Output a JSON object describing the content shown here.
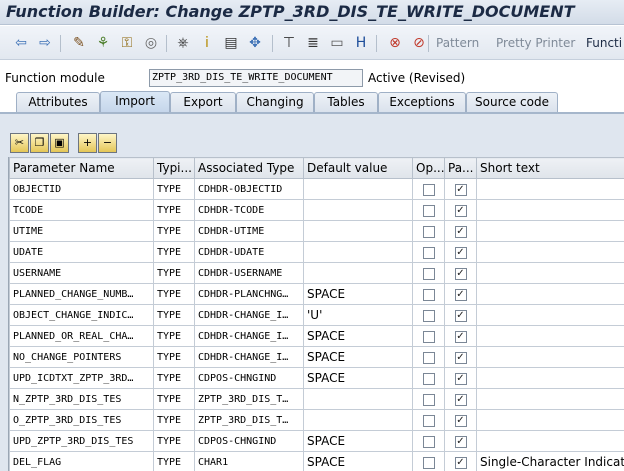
{
  "window": {
    "title": "Function Builder: Change ZPTP_3RD_DIS_TE_WRITE_DOCUMENT"
  },
  "toolbar": {
    "buttons": [
      {
        "name": "back-arrow-icon",
        "glyph": "⇦",
        "color": "#3a6fb5"
      },
      {
        "name": "forward-arrow-icon",
        "glyph": "⇨",
        "color": "#3a6fb5"
      },
      {
        "name": "display-change-icon",
        "glyph": "✎",
        "color": "#7a4f1e"
      },
      {
        "name": "other-object-icon",
        "glyph": "⚘",
        "color": "#4d7f2c"
      },
      {
        "name": "activate-icon",
        "glyph": "⚿",
        "color": "#8a6100"
      },
      {
        "name": "check-icon",
        "glyph": "◎",
        "color": "#666666"
      },
      {
        "name": "where-used-icon",
        "glyph": "⎈",
        "color": "#333333"
      },
      {
        "name": "info-icon",
        "glyph": "ⅰ",
        "color": "#b58a00"
      },
      {
        "name": "object-list-icon",
        "glyph": "▤",
        "color": "#333333"
      },
      {
        "name": "navigate-icon",
        "glyph": "✥",
        "color": "#3a6fb5"
      },
      {
        "name": "hierarchy-icon",
        "glyph": "⊤",
        "color": "#333333"
      },
      {
        "name": "stack-icon",
        "glyph": "≣",
        "color": "#333333"
      },
      {
        "name": "window-icon",
        "glyph": "▭",
        "color": "#555555"
      },
      {
        "name": "help-icon",
        "glyph": "H",
        "color": "#1e4e9a"
      },
      {
        "name": "set-breakpoint-icon",
        "glyph": "⊗",
        "color": "#c0392b"
      },
      {
        "name": "delete-breakpoint-icon",
        "glyph": "⊘",
        "color": "#c0392b"
      }
    ],
    "pattern_label": "Pattern",
    "pretty_printer_label": "Pretty Printer",
    "function_module_button_label": "Functi"
  },
  "function_module": {
    "label": "Function module",
    "value": "ZPTP_3RD_DIS_TE_WRITE_DOCUMENT",
    "status": "Active (Revised)"
  },
  "tabs": [
    {
      "label": "Attributes",
      "active": false
    },
    {
      "label": "Import",
      "active": true
    },
    {
      "label": "Export",
      "active": false
    },
    {
      "label": "Changing",
      "active": false
    },
    {
      "label": "Tables",
      "active": false
    },
    {
      "label": "Exceptions",
      "active": false
    },
    {
      "label": "Source code",
      "active": false
    }
  ],
  "table_toolbar": [
    {
      "name": "cut-icon",
      "glyph": "✂"
    },
    {
      "name": "copy-icon",
      "glyph": "❐"
    },
    {
      "name": "paste-icon",
      "glyph": "▣"
    },
    {
      "name": "insert-row-icon",
      "glyph": "+"
    },
    {
      "name": "delete-row-icon",
      "glyph": "−"
    }
  ],
  "table": {
    "headers": [
      "Parameter Name",
      "Typi...",
      "Associated Type",
      "Default value",
      "Op...",
      "Pa...",
      "Short text"
    ],
    "rows": [
      {
        "name": "OBJECTID",
        "typing": "TYPE",
        "assoc": "CDHDR-OBJECTID",
        "default": "",
        "optional": false,
        "pass_value": true,
        "short_text": ""
      },
      {
        "name": "TCODE",
        "typing": "TYPE",
        "assoc": "CDHDR-TCODE",
        "default": "",
        "optional": false,
        "pass_value": true,
        "short_text": ""
      },
      {
        "name": "UTIME",
        "typing": "TYPE",
        "assoc": "CDHDR-UTIME",
        "default": "",
        "optional": false,
        "pass_value": true,
        "short_text": ""
      },
      {
        "name": "UDATE",
        "typing": "TYPE",
        "assoc": "CDHDR-UDATE",
        "default": "",
        "optional": false,
        "pass_value": true,
        "short_text": ""
      },
      {
        "name": "USERNAME",
        "typing": "TYPE",
        "assoc": "CDHDR-USERNAME",
        "default": "",
        "optional": false,
        "pass_value": true,
        "short_text": ""
      },
      {
        "name": "PLANNED_CHANGE_NUMB…",
        "typing": "TYPE",
        "assoc": "CDHDR-PLANCHNG…",
        "default": "SPACE",
        "optional": false,
        "pass_value": true,
        "short_text": ""
      },
      {
        "name": "OBJECT_CHANGE_INDIC…",
        "typing": "TYPE",
        "assoc": "CDHDR-CHANGE_I…",
        "default": "'U'",
        "optional": false,
        "pass_value": true,
        "short_text": ""
      },
      {
        "name": "PLANNED_OR_REAL_CHA…",
        "typing": "TYPE",
        "assoc": "CDHDR-CHANGE_I…",
        "default": "SPACE",
        "optional": false,
        "pass_value": true,
        "short_text": ""
      },
      {
        "name": "NO_CHANGE_POINTERS",
        "typing": "TYPE",
        "assoc": "CDHDR-CHANGE_I…",
        "default": "SPACE",
        "optional": false,
        "pass_value": true,
        "short_text": ""
      },
      {
        "name": "UPD_ICDTXT_ZPTP_3RD…",
        "typing": "TYPE",
        "assoc": "CDPOS-CHNGIND",
        "default": "SPACE",
        "optional": false,
        "pass_value": true,
        "short_text": ""
      },
      {
        "name": "N_ZPTP_3RD_DIS_TES",
        "typing": "TYPE",
        "assoc": "ZPTP_3RD_DIS_T…",
        "default": "",
        "optional": false,
        "pass_value": true,
        "short_text": ""
      },
      {
        "name": "O_ZPTP_3RD_DIS_TES",
        "typing": "TYPE",
        "assoc": "ZPTP_3RD_DIS_T…",
        "default": "",
        "optional": false,
        "pass_value": true,
        "short_text": ""
      },
      {
        "name": "UPD_ZPTP_3RD_DIS_TES",
        "typing": "TYPE",
        "assoc": "CDPOS-CHNGIND",
        "default": "SPACE",
        "optional": false,
        "pass_value": true,
        "short_text": ""
      },
      {
        "name": "DEL_FLAG",
        "typing": "TYPE",
        "assoc": "CHAR1",
        "default": "SPACE",
        "optional": false,
        "pass_value": true,
        "short_text": "Single-Character Indicator"
      }
    ]
  }
}
